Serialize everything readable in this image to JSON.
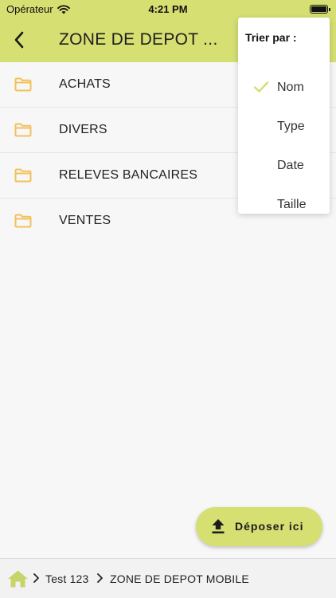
{
  "status_bar": {
    "carrier": "Opérateur",
    "time": "4:21 PM"
  },
  "nav": {
    "title": "ZONE DE DEPOT ..."
  },
  "folders": [
    {
      "label": "ACHATS"
    },
    {
      "label": "DIVERS"
    },
    {
      "label": "RELEVES BANCAIRES"
    },
    {
      "label": "VENTES"
    }
  ],
  "sort_menu": {
    "heading": "Trier par :",
    "options": [
      {
        "label": "Nom",
        "selected": true
      },
      {
        "label": "Type",
        "selected": false
      },
      {
        "label": "Date",
        "selected": false
      },
      {
        "label": "Taille",
        "selected": false
      }
    ]
  },
  "upload_button": {
    "label": "Déposer ici"
  },
  "breadcrumb": {
    "items": [
      "Test 123",
      "ZONE DE DEPOT MOBILE"
    ]
  },
  "colors": {
    "accent": "#d5df72",
    "folder": "#f2c15b",
    "home_icon": "#c7d46a"
  }
}
